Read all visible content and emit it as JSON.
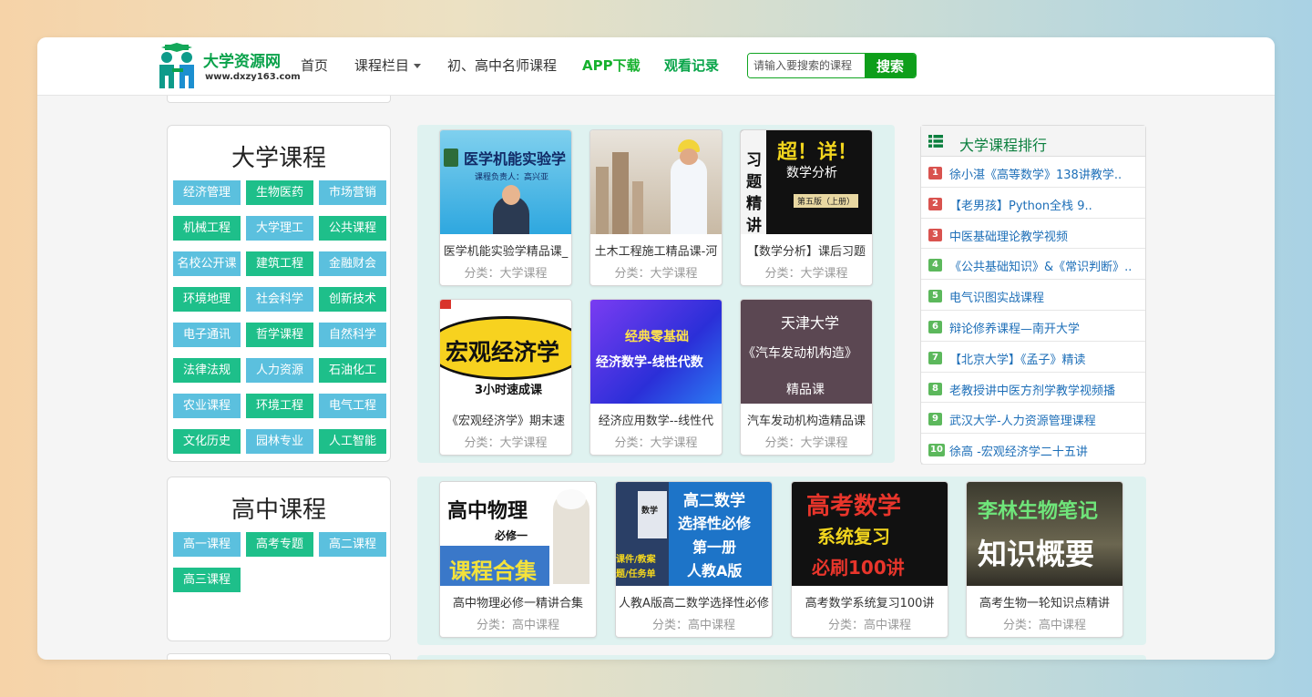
{
  "site": {
    "brand": "大学资源网",
    "url": "www.dxzy163.com"
  },
  "nav": {
    "home": "首页",
    "columns": "课程栏目",
    "teachers": "初、高中名师课程",
    "app": "APP下载",
    "history": "观看记录"
  },
  "search": {
    "placeholder": "请输入要搜索的课程",
    "button": "搜索"
  },
  "university": {
    "title": "大学课程",
    "tags": [
      {
        "label": "经济管理",
        "color": "blue"
      },
      {
        "label": "生物医药",
        "color": "green"
      },
      {
        "label": "市场营销",
        "color": "blue"
      },
      {
        "label": "机械工程",
        "color": "green"
      },
      {
        "label": "大学理工",
        "color": "blue"
      },
      {
        "label": "公共课程",
        "color": "green"
      },
      {
        "label": "名校公开课",
        "color": "blue"
      },
      {
        "label": "建筑工程",
        "color": "green"
      },
      {
        "label": "金融财会",
        "color": "blue"
      },
      {
        "label": "环境地理",
        "color": "green"
      },
      {
        "label": "社会科学",
        "color": "blue"
      },
      {
        "label": "创新技术",
        "color": "green"
      },
      {
        "label": "电子通讯",
        "color": "blue"
      },
      {
        "label": "哲学课程",
        "color": "green"
      },
      {
        "label": "自然科学",
        "color": "blue"
      },
      {
        "label": "法律法规",
        "color": "green"
      },
      {
        "label": "人力资源",
        "color": "blue"
      },
      {
        "label": "石油化工",
        "color": "green"
      },
      {
        "label": "农业课程",
        "color": "blue"
      },
      {
        "label": "环境工程",
        "color": "green"
      },
      {
        "label": "电气工程",
        "color": "blue"
      },
      {
        "label": "文化历史",
        "color": "green"
      },
      {
        "label": "园林专业",
        "color": "blue"
      },
      {
        "label": "人工智能",
        "color": "green"
      }
    ],
    "courses": [
      {
        "title": "医学机能实验学精品课_",
        "category": "分类：大学课程",
        "cover": [
          "医学机能实验学",
          "课程负责人：高兴亚"
        ]
      },
      {
        "title": "土木工程施工精品课-河",
        "category": "分类：大学课程",
        "cover": []
      },
      {
        "title": "【数学分析】课后习题",
        "category": "分类：大学课程",
        "cover": [
          "超！详！",
          "数学分析",
          "习",
          "题",
          "精",
          "讲",
          "第五版（上册）"
        ]
      },
      {
        "title": "《宏观经济学》期末速",
        "category": "分类：大学课程",
        "cover": [
          "宏观经济学",
          "3小时速成课"
        ]
      },
      {
        "title": "经济应用数学--线性代",
        "category": "分类：大学课程",
        "cover": [
          "经典零基础",
          "经济数学-线性代数"
        ]
      },
      {
        "title": "汽车发动机构造精品课",
        "category": "分类：大学课程",
        "cover": [
          "天津大学",
          "《汽车发动机构造》",
          "精品课"
        ]
      }
    ]
  },
  "highschool": {
    "title": "高中课程",
    "tags": [
      {
        "label": "高一课程",
        "color": "blue"
      },
      {
        "label": "高考专题",
        "color": "green"
      },
      {
        "label": "高二课程",
        "color": "blue"
      },
      {
        "label": "高三课程",
        "color": "green"
      }
    ],
    "courses": [
      {
        "title": "高中物理必修一精讲合集",
        "category": "分类：高中课程",
        "cover": [
          "高中物理",
          "必修一",
          "课程合集"
        ]
      },
      {
        "title": "人教A版高二数学选择性必修",
        "category": "分类：高中课程",
        "cover": [
          "高二数学",
          "选择性必修",
          "第一册",
          "人教A版",
          "课件/教案",
          "题/任务单",
          "数学"
        ]
      },
      {
        "title": "高考数学系统复习100讲",
        "category": "分类：高中课程",
        "cover": [
          "高考数学",
          "系统复习",
          "必刷100讲"
        ]
      },
      {
        "title": "高考生物一轮知识点精讲",
        "category": "分类：高中课程",
        "cover": [
          "李林生物笔记",
          "知识概要"
        ]
      }
    ]
  },
  "ranking": {
    "title": "大学课程排行",
    "items": [
      {
        "num": "1",
        "text": "徐小湛《高等数学》138讲教学..",
        "color": "#d9534f"
      },
      {
        "num": "2",
        "text": "【老男孩】Python全栈 9..",
        "color": "#d9534f"
      },
      {
        "num": "3",
        "text": "中医基础理论教学视频",
        "color": "#d9534f"
      },
      {
        "num": "4",
        "text": "《公共基础知识》&《常识判断》..",
        "color": "#5cb85c"
      },
      {
        "num": "5",
        "text": "电气识图实战课程",
        "color": "#5cb85c"
      },
      {
        "num": "6",
        "text": "辩论修养课程—南开大学",
        "color": "#5cb85c"
      },
      {
        "num": "7",
        "text": "【北京大学】《孟子》精读",
        "color": "#5cb85c"
      },
      {
        "num": "8",
        "text": "老教授讲中医方剂学教学视频播",
        "color": "#5cb85c"
      },
      {
        "num": "9",
        "text": "武汉大学-人力资源管理课程",
        "color": "#5cb85c"
      },
      {
        "num": "10",
        "text": "徐高 -宏观经济学二十五讲",
        "color": "#5cb85c"
      }
    ]
  }
}
